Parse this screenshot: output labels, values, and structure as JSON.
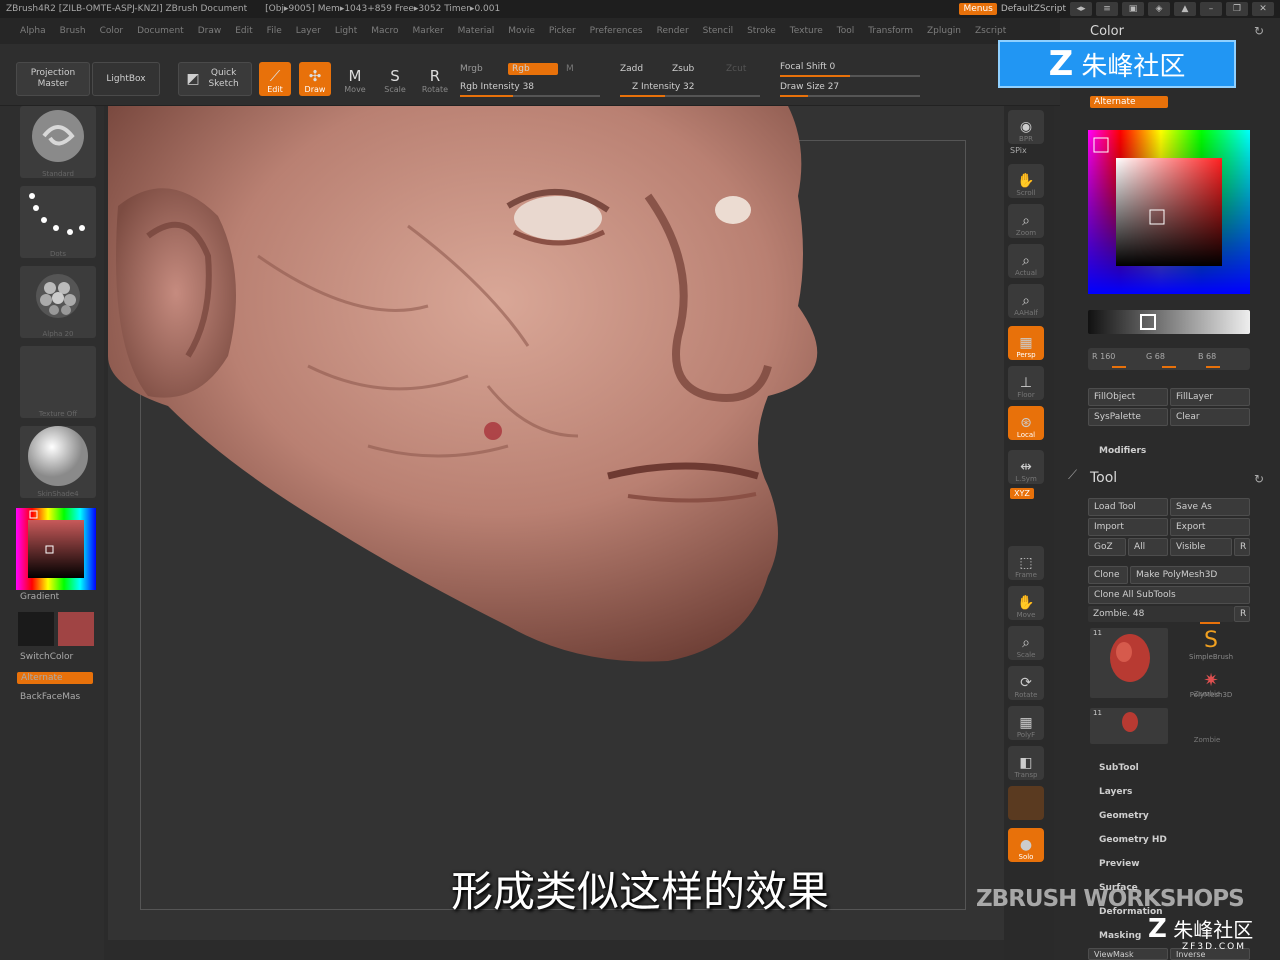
{
  "titlebar": {
    "app": "ZBrush4R2 [ZILB-OMTE-ASPJ-KNZI]   ZBrush Document",
    "stats": "[Obj▸9005] Mem▸1043+859 Free▸3052 Timer▸0.001",
    "menus_btn": "Menus",
    "script": "DefaultZScript"
  },
  "menubar": [
    "Alpha",
    "Brush",
    "Color",
    "Document",
    "Draw",
    "Edit",
    "File",
    "Layer",
    "Light",
    "Macro",
    "Marker",
    "Material",
    "Movie",
    "Picker",
    "Preferences",
    "Render",
    "Stencil",
    "Stroke",
    "Texture",
    "Tool",
    "Transform",
    "Zplugin",
    "Zscript"
  ],
  "topshelf": {
    "projection_master": "Projection Master",
    "lightbox": "LightBox",
    "quick_sketch": "Quick Sketch",
    "tools": [
      {
        "label": "Edit",
        "glyph": "⟋",
        "on": true
      },
      {
        "label": "Draw",
        "glyph": "✣",
        "on": true
      },
      {
        "label": "Move",
        "glyph": "M",
        "on": false
      },
      {
        "label": "Scale",
        "glyph": "S",
        "on": false
      },
      {
        "label": "Rotate",
        "glyph": "R",
        "on": false
      }
    ],
    "mrgb": "Mrgb",
    "rgb": "Rgb",
    "m": "M",
    "rgb_intensity": "Rgb Intensity 38",
    "zadd": "Zadd",
    "zsub": "Zsub",
    "zcut": "Zcut",
    "z_intensity": "Z Intensity 32",
    "focal_shift": "Focal Shift 0",
    "draw_size": "Draw Size 27",
    "rgb_intensity_level": 0.38,
    "z_intensity_level": 0.32,
    "focal_shift_level": 0.5,
    "draw_size_level": 0.2
  },
  "leftshelf": {
    "brush_cap": "Standard",
    "stroke_cap": "Dots",
    "alpha_cap": "Alpha 20",
    "texture_cap": "Texture Off",
    "material_cap": "SkinShade4",
    "gradient": "Gradient",
    "switchcolor": "SwitchColor",
    "alternate": "Alternate",
    "backface": "BackFaceMas"
  },
  "rightshelf": [
    {
      "label": "BPR",
      "glyph": "◉",
      "on": false
    },
    {
      "label": "Scroll",
      "glyph": "✋",
      "on": false
    },
    {
      "label": "Zoom",
      "glyph": "⌕",
      "on": false
    },
    {
      "label": "Actual",
      "glyph": "⌕",
      "on": false
    },
    {
      "label": "AAHalf",
      "glyph": "⌕",
      "on": false
    },
    {
      "label": "Persp",
      "glyph": "▦",
      "on": true
    },
    {
      "label": "Floor",
      "glyph": "⊥",
      "on": false
    },
    {
      "label": "Local",
      "glyph": "⊛",
      "on": true
    },
    {
      "label": "L.Sym",
      "glyph": "⇹",
      "on": false
    },
    {
      "label": "Frame",
      "glyph": "⬚",
      "on": false
    },
    {
      "label": "Move",
      "glyph": "✋",
      "on": false
    },
    {
      "label": "Scale",
      "glyph": "⌕",
      "on": false
    },
    {
      "label": "Rotate",
      "glyph": "⟳",
      "on": false
    },
    {
      "label": "PolyF",
      "glyph": "▦",
      "on": false
    },
    {
      "label": "Transp",
      "glyph": "◧",
      "on": false
    },
    {
      "label": "Solo",
      "glyph": "●",
      "on": true
    }
  ],
  "rightshelf_xyz": "XYZ",
  "rightshelf_spix": "SPix",
  "tray": {
    "color_title": "Color",
    "alternate": "Alternate",
    "r": "R 160",
    "g": "G 68",
    "b": "B 68",
    "fillobject": "FillObject",
    "filllayer": "FillLayer",
    "syspalette": "SysPalette",
    "clear": "Clear",
    "modifiers": "Modifiers",
    "tool_title": "Tool",
    "load_tool": "Load Tool",
    "save_as": "Save As",
    "import": "Import",
    "export": "Export",
    "goz": "GoZ",
    "all": "All",
    "visible": "Visible",
    "r_btn": "R",
    "clone": "Clone",
    "make_polymesh": "Make PolyMesh3D",
    "clone_all": "Clone  All  SubTools",
    "zombie": "Zombie. 48",
    "count1": "11",
    "count2": "11",
    "simplebrush": "SimpleBrush",
    "polymesh3d": "PolyMesh3D",
    "zombie_cap": "Zombie",
    "zombie_cap2": "Zombie",
    "sections": [
      "SubTool",
      "Layers",
      "Geometry",
      "Geometry HD",
      "Preview",
      "Surface",
      "Deformation",
      "Masking"
    ],
    "viewmask": "ViewMask",
    "inverse": "Inverse"
  },
  "subtitle": "形成类似这样的效果",
  "watermark": {
    "banner": "朱峰社区",
    "zbw": "ZBRUSH WORKSHOPS",
    "logo": "朱峰社区",
    "logo_sub": "ZF3D.COM"
  },
  "colors": {
    "accent": "#e8710a",
    "secondary_color": "#a04444",
    "main_color": "#1a1a1a"
  }
}
